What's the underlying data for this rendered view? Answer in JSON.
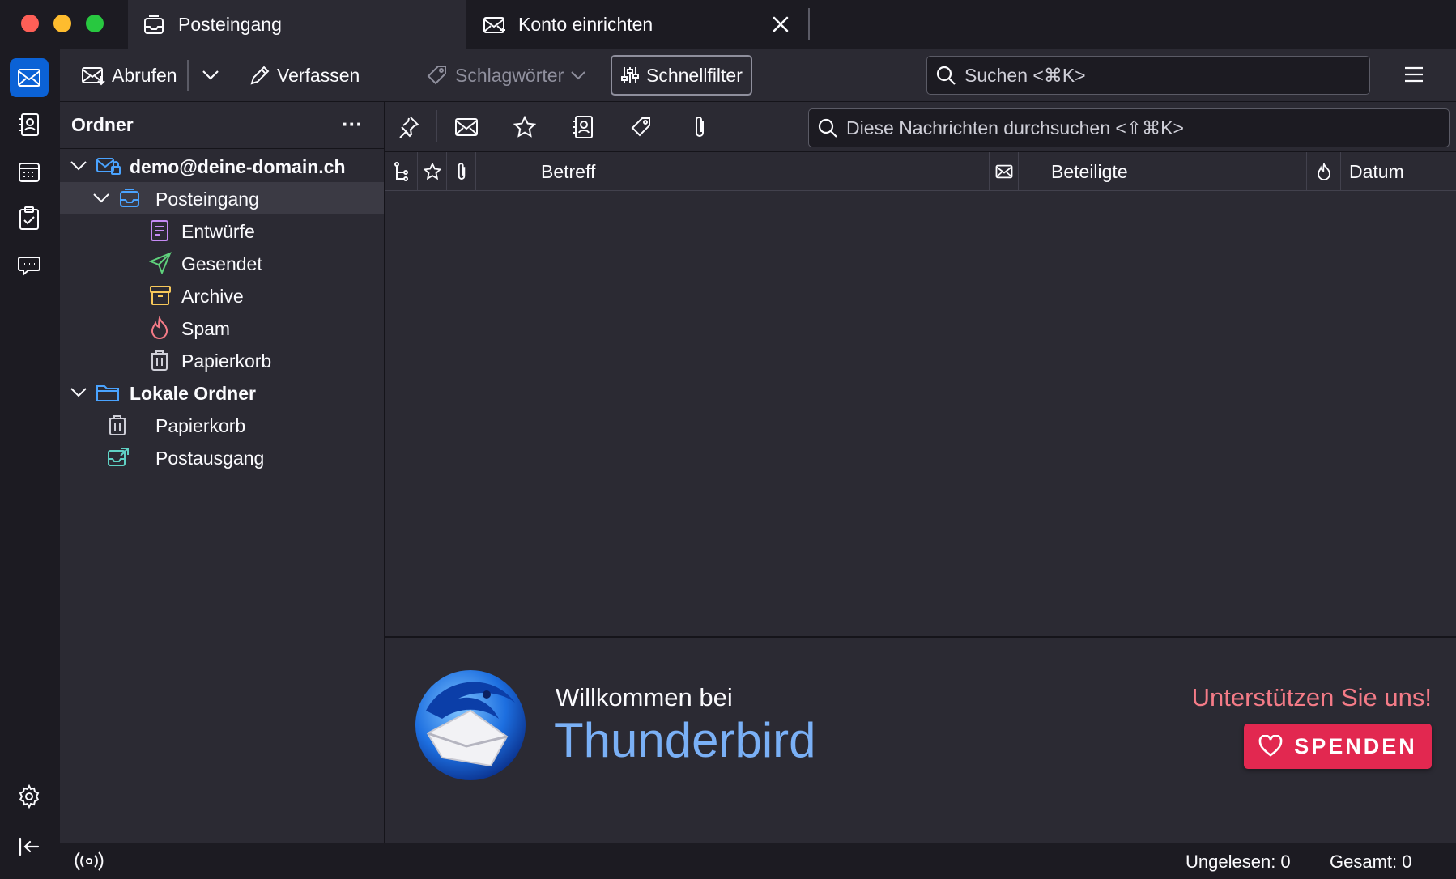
{
  "window": {
    "tabs": [
      {
        "label": "Posteingang",
        "icon": "inbox-icon",
        "active": true
      },
      {
        "label": "Konto einrichten",
        "icon": "account-setup-icon",
        "active": false
      }
    ]
  },
  "spaces": [
    "mail-icon",
    "address-book-icon",
    "calendar-icon",
    "tasks-icon",
    "chat-icon",
    "settings-icon",
    "collapse-icon"
  ],
  "toolbar": {
    "get_messages_label": "Abrufen",
    "write_label": "Verfassen",
    "tags_label": "Schlagwörter",
    "quick_filter_label": "Schnellfilter",
    "search_placeholder": "Suchen <⌘K>"
  },
  "folder_pane": {
    "header": "Ordner",
    "menu_glyph": "···",
    "folders": [
      {
        "label": "demo@deine-domain.ch",
        "icon": "account-icon",
        "level": 0,
        "bold": true,
        "expanded": true
      },
      {
        "label": "Posteingang",
        "icon": "inbox-icon",
        "level": 1,
        "selected": true,
        "expanded": true
      },
      {
        "label": "Entwürfe",
        "icon": "drafts-icon",
        "level": 2
      },
      {
        "label": "Gesendet",
        "icon": "sent-icon",
        "level": 2
      },
      {
        "label": "Archive",
        "icon": "archive-icon",
        "level": 2
      },
      {
        "label": "Spam",
        "icon": "spam-icon",
        "level": 2
      },
      {
        "label": "Papierkorb",
        "icon": "trash-icon",
        "level": 2
      },
      {
        "label": "Lokale Ordner",
        "icon": "local-folder-icon",
        "level": 0,
        "bold": true,
        "expanded": true
      },
      {
        "label": "Papierkorb",
        "icon": "trash-icon",
        "level": 1
      },
      {
        "label": "Postausgang",
        "icon": "outbox-icon",
        "level": 1
      }
    ]
  },
  "quick_filter": {
    "search_placeholder": "Diese Nachrichten durchsuchen <⇧⌘K>",
    "buttons": [
      "pin-icon",
      "unread-icon",
      "star-icon",
      "contact-icon",
      "tag-icon",
      "attachment-icon"
    ]
  },
  "thread_columns": {
    "subject": "Betreff",
    "correspondents": "Beteiligte",
    "date": "Datum"
  },
  "start_page": {
    "welcome": "Willkommen bei",
    "brand": "Thunderbird",
    "support": "Unterstützen Sie uns!",
    "donate": "SPENDEN"
  },
  "status": {
    "unread": "Ungelesen: 0",
    "total": "Gesamt: 0"
  },
  "colors": {
    "accent": "#0b62d6",
    "brand_text": "#7ab0f6",
    "donate": "#e22850",
    "support_text": "#f47b87"
  }
}
